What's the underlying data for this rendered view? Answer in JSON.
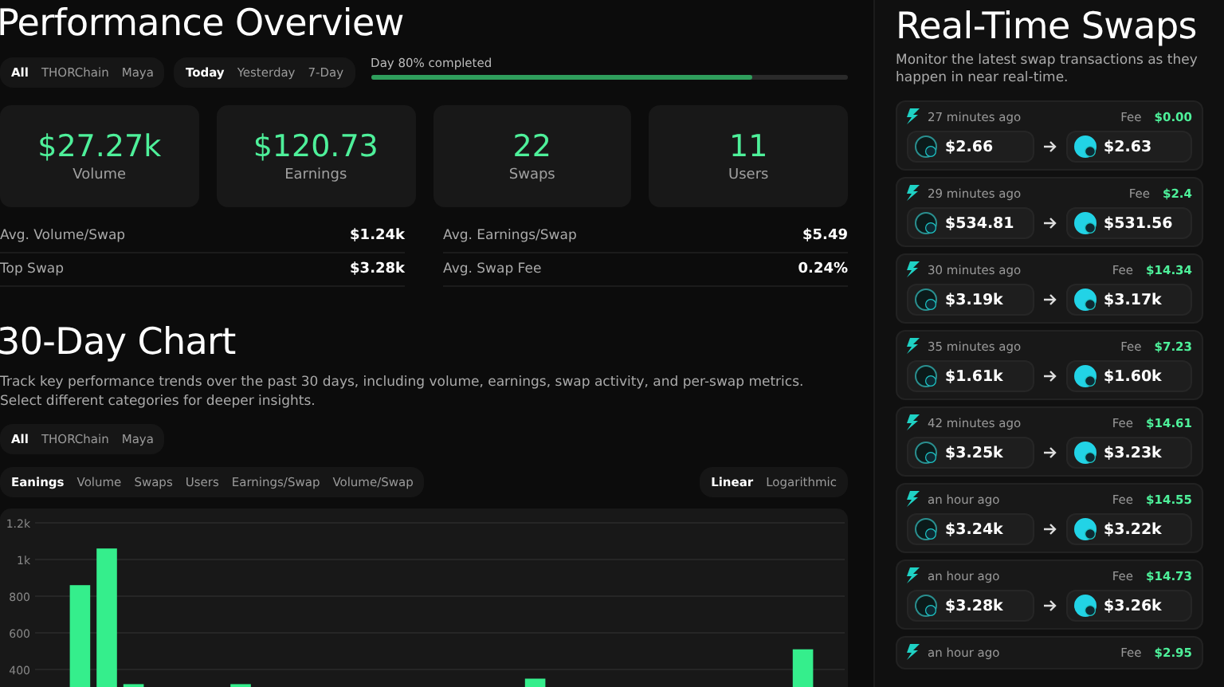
{
  "overview": {
    "title": "Performance Overview",
    "network_filter": [
      {
        "label": "All",
        "selected": true
      },
      {
        "label": "THORChain",
        "selected": false
      },
      {
        "label": "Maya",
        "selected": false
      }
    ],
    "period_filter": [
      {
        "label": "Today",
        "selected": true
      },
      {
        "label": "Yesterday",
        "selected": false
      },
      {
        "label": "7-Day",
        "selected": false
      }
    ],
    "day_progress": {
      "label": "Day 80% completed",
      "level": 0.8
    },
    "stat_cards": [
      {
        "value": "$27.27k",
        "label": "Volume"
      },
      {
        "value": "$120.73",
        "label": "Earnings"
      },
      {
        "value": "22",
        "label": "Swaps"
      },
      {
        "value": "11",
        "label": "Users"
      }
    ],
    "stats": [
      {
        "label": "Avg. Volume/Swap",
        "value": "$1.24k"
      },
      {
        "label": "Avg. Earnings/Swap",
        "value": "$5.49"
      },
      {
        "label": "Top Swap",
        "value": "$3.28k"
      },
      {
        "label": "Avg. Swap Fee",
        "value": "0.24%"
      }
    ]
  },
  "chart_section": {
    "title": "30-Day Chart",
    "description": "Track key performance trends over the past 30 days, including volume, earnings, swap activity, and per-swap metrics. Select different categories for deeper insights.",
    "network_filter": [
      {
        "label": "All",
        "selected": true
      },
      {
        "label": "THORChain",
        "selected": false
      },
      {
        "label": "Maya",
        "selected": false
      }
    ],
    "metric_tabs": [
      {
        "label": "Eanings",
        "selected": true
      },
      {
        "label": "Volume",
        "selected": false
      },
      {
        "label": "Swaps",
        "selected": false
      },
      {
        "label": "Users",
        "selected": false
      },
      {
        "label": "Earnings/Swap",
        "selected": false
      },
      {
        "label": "Volume/Swap",
        "selected": false
      }
    ],
    "scale_tabs": [
      {
        "label": "Linear",
        "selected": true
      },
      {
        "label": "Logarithmic",
        "selected": false
      }
    ],
    "chart_data": {
      "type": "bar",
      "grid": true,
      "ylim": [
        0,
        1200
      ],
      "yticks": [
        400,
        600,
        800,
        {
          "value": 1000,
          "label": "1k"
        },
        {
          "value": 1200,
          "label": "1.2k"
        }
      ],
      "values": [
        null,
        860,
        1060,
        320,
        null,
        null,
        null,
        320,
        null,
        null,
        null,
        null,
        null,
        null,
        null,
        null,
        null,
        null,
        350,
        null,
        null,
        null,
        null,
        null,
        null,
        null,
        null,
        null,
        510,
        null
      ]
    }
  },
  "swaps_panel": {
    "title": "Real-Time Swaps",
    "description": "Monitor the latest swap transactions as they happen in near real-time.",
    "swaps": [
      {
        "time": "27 minutes ago",
        "fee_label": "Fee",
        "fee": "$0.00",
        "from_amount": "$2.66",
        "to_amount": "$2.63"
      },
      {
        "time": "29 minutes ago",
        "fee_label": "Fee",
        "fee": "$2.4",
        "from_amount": "$534.81",
        "to_amount": "$531.56"
      },
      {
        "time": "30 minutes ago",
        "fee_label": "Fee",
        "fee": "$14.34",
        "from_amount": "$3.19k",
        "to_amount": "$3.17k"
      },
      {
        "time": "35 minutes ago",
        "fee_label": "Fee",
        "fee": "$7.23",
        "from_amount": "$1.61k",
        "to_amount": "$1.60k"
      },
      {
        "time": "42 minutes ago",
        "fee_label": "Fee",
        "fee": "$14.61",
        "from_amount": "$3.25k",
        "to_amount": "$3.23k"
      },
      {
        "time": "an hour ago",
        "fee_label": "Fee",
        "fee": "$14.55",
        "from_amount": "$3.24k",
        "to_amount": "$3.22k"
      },
      {
        "time": "an hour ago",
        "fee_label": "Fee",
        "fee": "$14.73",
        "from_amount": "$3.28k",
        "to_amount": "$3.26k"
      },
      {
        "time": "an hour ago",
        "fee_label": "Fee",
        "fee": "$2.95"
      }
    ]
  }
}
